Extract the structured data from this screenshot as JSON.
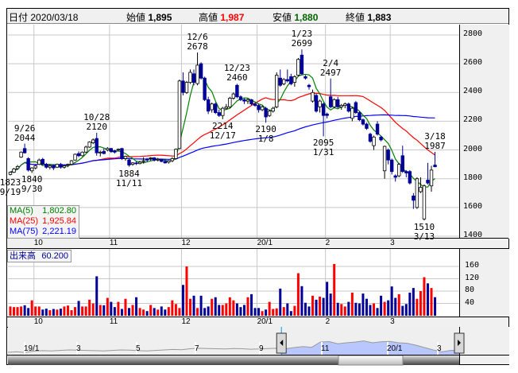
{
  "header": {
    "date_label": "日付",
    "date": "2020/03/18",
    "open_label": "始値",
    "open": "1,895",
    "high_label": "高値",
    "high": "1,987",
    "low_label": "安値",
    "low": "1,880",
    "close_label": "終値",
    "close": "1,883"
  },
  "colors": {
    "up": "#ff0000",
    "down": "#000099",
    "ma5": "#008000",
    "ma25": "#ff0000",
    "ma75": "#0000ff",
    "grid": "#c8c8c8",
    "high": "#ff0000",
    "low": "#006400"
  },
  "legend": {
    "ma": [
      {
        "label": "MA(5)",
        "value": "1,802.80",
        "color": "#008000"
      },
      {
        "label": "MA(25)",
        "value": "1,925.84",
        "color": "#ff0000"
      },
      {
        "label": "MA(75)",
        "value": "2,221.19",
        "color": "#0000ff"
      }
    ],
    "volume_label": "出来高",
    "volume_value": "60.200"
  },
  "chart_data": {
    "type": "candlestick",
    "title": "",
    "price_axis": {
      "ticks": [
        "2800",
        "2600",
        "2400",
        "2200",
        "2000",
        "1800",
        "1600",
        "1400"
      ],
      "range": [
        1400,
        2800
      ]
    },
    "volume_axis": {
      "ticks": [
        "160",
        "120",
        "80",
        "40"
      ],
      "range": [
        0,
        180
      ]
    },
    "month_ticks": [
      {
        "label": "10",
        "index": 7
      },
      {
        "label": "11",
        "index": 28
      },
      {
        "label": "12",
        "index": 48
      },
      {
        "label": "20/1",
        "index": 69
      },
      {
        "label": "2",
        "index": 88
      },
      {
        "label": "3",
        "index": 106
      }
    ],
    "ohlc": [
      [
        1830,
        1850,
        1823,
        1845
      ],
      [
        1845,
        1875,
        1840,
        1868
      ],
      [
        1870,
        1895,
        1862,
        1885
      ],
      [
        1950,
        1990,
        1945,
        1985
      ],
      [
        2010,
        2044,
        1975,
        1980
      ],
      [
        1940,
        1950,
        1850,
        1860
      ],
      [
        1855,
        1880,
        1840,
        1875
      ],
      [
        1875,
        1895,
        1865,
        1890
      ],
      [
        1900,
        1940,
        1895,
        1930
      ],
      [
        1935,
        1945,
        1895,
        1900
      ],
      [
        1900,
        1910,
        1870,
        1880
      ],
      [
        1880,
        1900,
        1865,
        1890
      ],
      [
        1890,
        1900,
        1860,
        1875
      ],
      [
        1880,
        1905,
        1875,
        1900
      ],
      [
        1900,
        1910,
        1870,
        1880
      ],
      [
        1880,
        1895,
        1870,
        1890
      ],
      [
        1895,
        1905,
        1880,
        1900
      ],
      [
        1900,
        1930,
        1895,
        1925
      ],
      [
        1930,
        1975,
        1925,
        1970
      ],
      [
        1975,
        1990,
        1950,
        1960
      ],
      [
        1960,
        1990,
        1955,
        1985
      ],
      [
        1985,
        2030,
        1980,
        2020
      ],
      [
        2020,
        2060,
        2015,
        2055
      ],
      [
        2050,
        2080,
        2040,
        2070
      ],
      [
        2080,
        2120,
        1960,
        1980
      ],
      [
        1980,
        1995,
        1955,
        1985
      ],
      [
        1990,
        2010,
        1970,
        1975
      ],
      [
        2000,
        2020,
        1990,
        2010
      ],
      [
        2010,
        2015,
        1980,
        1990
      ],
      [
        1995,
        2000,
        1975,
        1985
      ],
      [
        2000,
        2010,
        1990,
        2005
      ],
      [
        2010,
        2015,
        1930,
        1940
      ],
      [
        1940,
        1960,
        1925,
        1955
      ],
      [
        1930,
        1945,
        1884,
        1895
      ],
      [
        1900,
        1915,
        1890,
        1910
      ],
      [
        1910,
        1920,
        1895,
        1905
      ],
      [
        1905,
        1925,
        1900,
        1915
      ],
      [
        1920,
        1950,
        1905,
        1925
      ],
      [
        1935,
        1945,
        1915,
        1930
      ],
      [
        1940,
        1950,
        1925,
        1945
      ],
      [
        1945,
        1950,
        1920,
        1930
      ],
      [
        1930,
        1945,
        1920,
        1935
      ],
      [
        1935,
        1940,
        1915,
        1920
      ],
      [
        1920,
        1935,
        1905,
        1910
      ],
      [
        1915,
        1930,
        1905,
        1925
      ],
      [
        1925,
        1950,
        1915,
        1940
      ],
      [
        1940,
        2010,
        1935,
        2005
      ],
      [
        2010,
        2490,
        2005,
        2480
      ],
      [
        2480,
        2540,
        2380,
        2400
      ],
      [
        2400,
        2480,
        2390,
        2470
      ],
      [
        2470,
        2560,
        2460,
        2540
      ],
      [
        2530,
        2560,
        2450,
        2470
      ],
      [
        2462,
        2678,
        2450,
        2590
      ],
      [
        2600,
        2610,
        2490,
        2500
      ],
      [
        2500,
        2510,
        2340,
        2350
      ],
      [
        2350,
        2370,
        2250,
        2270
      ],
      [
        2280,
        2330,
        2260,
        2320
      ],
      [
        2320,
        2330,
        2250,
        2260
      ],
      [
        2260,
        2280,
        2230,
        2240
      ],
      [
        2240,
        2300,
        2214,
        2290
      ],
      [
        2290,
        2320,
        2280,
        2300
      ],
      [
        2300,
        2370,
        2290,
        2360
      ],
      [
        2360,
        2400,
        2350,
        2390
      ],
      [
        2450,
        2460,
        2360,
        2370
      ],
      [
        2370,
        2380,
        2340,
        2350
      ],
      [
        2350,
        2360,
        2320,
        2340
      ],
      [
        2340,
        2360,
        2320,
        2350
      ],
      [
        2350,
        2355,
        2310,
        2320
      ],
      [
        2320,
        2330,
        2300,
        2310
      ],
      [
        2310,
        2320,
        2260,
        2280
      ],
      [
        2280,
        2310,
        2270,
        2300
      ],
      [
        2290,
        2300,
        2190,
        2230
      ],
      [
        2240,
        2280,
        2230,
        2270
      ],
      [
        2270,
        2300,
        2260,
        2290
      ],
      [
        2300,
        2540,
        2290,
        2520
      ],
      [
        2500,
        2560,
        2440,
        2450
      ],
      [
        2460,
        2500,
        2450,
        2490
      ],
      [
        2490,
        2560,
        2470,
        2480
      ],
      [
        2510,
        2530,
        2450,
        2460
      ],
      [
        2470,
        2520,
        2440,
        2510
      ],
      [
        2520,
        2640,
        2510,
        2630
      ],
      [
        2660,
        2699,
        2520,
        2530
      ],
      [
        2510,
        2520,
        2490,
        2500
      ],
      [
        2450,
        2460,
        2420,
        2440
      ],
      [
        2340,
        2420,
        2330,
        2400
      ],
      [
        2380,
        2390,
        2260,
        2270
      ],
      [
        2300,
        2350,
        2260,
        2340
      ],
      [
        2320,
        2330,
        2095,
        2240
      ],
      [
        2250,
        2260,
        2220,
        2240
      ],
      [
        2370,
        2497,
        2290,
        2300
      ],
      [
        2300,
        2360,
        2290,
        2350
      ],
      [
        2350,
        2370,
        2290,
        2300
      ],
      [
        2300,
        2320,
        2280,
        2310
      ],
      [
        2310,
        2330,
        2290,
        2320
      ],
      [
        2320,
        2330,
        2260,
        2270
      ],
      [
        2220,
        2300,
        2200,
        2290
      ],
      [
        2330,
        2340,
        2250,
        2260
      ],
      [
        2260,
        2270,
        2200,
        2210
      ],
      [
        2210,
        2220,
        2170,
        2180
      ],
      [
        2180,
        2190,
        2140,
        2150
      ],
      [
        2110,
        2120,
        2050,
        2060
      ],
      [
        2030,
        2100,
        2000,
        2090
      ],
      [
        2180,
        2200,
        2100,
        2110
      ],
      [
        2090,
        2100,
        2060,
        2070
      ],
      [
        1855,
        2030,
        1800,
        2025
      ],
      [
        2000,
        2010,
        1900,
        1930
      ],
      [
        1930,
        1940,
        1830,
        1850
      ],
      [
        1820,
        1830,
        1780,
        1810
      ],
      [
        1820,
        1910,
        1810,
        1900
      ],
      [
        1960,
        2030,
        1840,
        1850
      ],
      [
        1850,
        1860,
        1810,
        1840
      ],
      [
        1850,
        1860,
        1760,
        1770
      ],
      [
        1680,
        1700,
        1590,
        1650
      ],
      [
        1600,
        1810,
        1590,
        1800
      ],
      [
        1710,
        1810,
        1700,
        1740
      ],
      [
        1520,
        1760,
        1510,
        1750
      ],
      [
        1790,
        1910,
        1760,
        1770
      ],
      [
        1750,
        1890,
        1710,
        1860
      ],
      [
        1895,
        1987,
        1880,
        1883
      ]
    ],
    "volume": [
      30,
      28,
      28,
      30,
      34,
      25,
      50,
      30,
      30,
      20,
      23,
      18,
      22,
      20,
      23,
      30,
      33,
      18,
      28,
      48,
      30,
      30,
      52,
      40,
      128,
      35,
      34,
      58,
      45,
      28,
      45,
      22,
      55,
      25,
      35,
      60,
      25,
      20,
      15,
      35,
      25,
      20,
      30,
      20,
      28,
      50,
      38,
      25,
      100,
      160,
      55,
      65,
      25,
      65,
      25,
      30,
      55,
      60,
      35,
      35,
      40,
      60,
      50,
      40,
      28,
      35,
      60,
      70,
      25,
      25,
      15,
      20,
      45,
      22,
      24,
      88,
      28,
      40,
      15,
      32,
      138,
      96,
      42,
      30,
      65,
      52,
      62,
      58,
      110,
      72,
      168,
      42,
      38,
      30,
      45,
      75,
      42,
      40,
      72,
      55,
      35,
      40,
      25,
      65,
      45,
      50,
      95,
      58,
      70,
      32,
      38,
      75,
      90,
      55,
      80,
      125,
      105,
      90,
      60.2
    ],
    "moving_averages": [
      {
        "name": "MA(5)",
        "period": 5
      },
      {
        "name": "MA(25)",
        "period": 25
      },
      {
        "name": "MA(75)",
        "period": 75
      }
    ],
    "annotations": [
      {
        "index": 0,
        "pos": "below",
        "lines": [
          "1823",
          "9/19"
        ]
      },
      {
        "index": 4,
        "pos": "above",
        "lines": [
          "9/26",
          "2044"
        ]
      },
      {
        "index": 6,
        "pos": "below",
        "lines": [
          "1840",
          "9/30"
        ]
      },
      {
        "index": 24,
        "pos": "above",
        "lines": [
          "10/28",
          "2120"
        ]
      },
      {
        "index": 33,
        "pos": "below",
        "lines": [
          "1884",
          "11/11"
        ]
      },
      {
        "index": 52,
        "pos": "above",
        "lines": [
          "12/6",
          "2678"
        ]
      },
      {
        "index": 59,
        "pos": "below",
        "lines": [
          "2214",
          "12/17"
        ]
      },
      {
        "index": 63,
        "pos": "above",
        "lines": [
          "12/23",
          "2460"
        ]
      },
      {
        "index": 71,
        "pos": "below",
        "lines": [
          "2190",
          "1/8"
        ]
      },
      {
        "index": 81,
        "pos": "above",
        "lines": [
          "1/23",
          "2699"
        ]
      },
      {
        "index": 87,
        "pos": "below",
        "lines": [
          "2095",
          "1/31"
        ]
      },
      {
        "index": 89,
        "pos": "above",
        "lines": [
          "2/4",
          "2497"
        ]
      },
      {
        "index": 115,
        "pos": "below",
        "lines": [
          "1510",
          "3/13"
        ]
      },
      {
        "index": 118,
        "pos": "above",
        "lines": [
          "3/18",
          "1987"
        ]
      }
    ]
  },
  "navigator": {
    "labels": [
      "19/1",
      "3",
      "5",
      "7",
      "9",
      "11",
      "20/1",
      "3"
    ],
    "series": [
      1800,
      1820,
      1790,
      1850,
      1870,
      1860,
      1880,
      1900,
      1890,
      1880,
      1870,
      1860,
      1880,
      1900,
      1890,
      1870,
      1860,
      1880,
      1900,
      1920,
      1910,
      1950,
      1970,
      1960,
      1950,
      1940,
      1960,
      1950,
      1930,
      1940,
      1960,
      1970,
      1950,
      2000,
      2040,
      2010,
      2230,
      2250,
      2160,
      2200,
      2230,
      2280,
      2200,
      2240,
      2260,
      2200,
      2180,
      2100,
      2000,
      1900,
      1820,
      1880,
      1900
    ],
    "selected_from_fraction": 0.606
  }
}
